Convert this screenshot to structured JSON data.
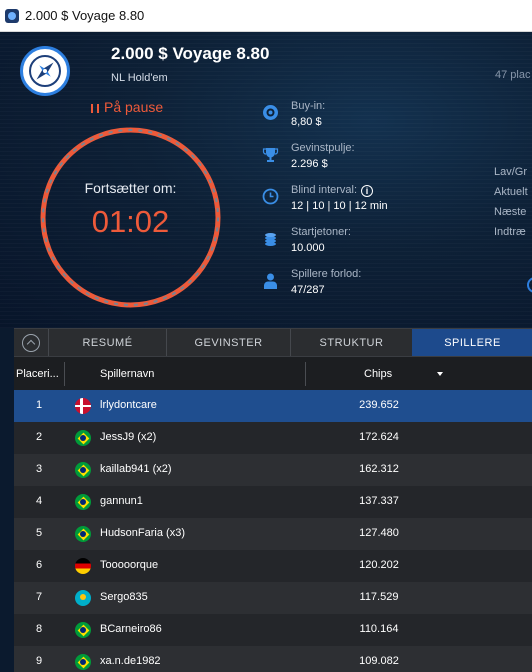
{
  "window": {
    "title": "2.000 $ Voyage 8.80"
  },
  "tournament": {
    "name": "2.000 $ Voyage 8.80",
    "game": "NL Hold'em",
    "right_partial": "47 plac"
  },
  "status": {
    "pause_text": "På pause"
  },
  "timer": {
    "label": "Fortsætter om:",
    "value": "01:02"
  },
  "info": {
    "buyin": {
      "label": "Buy-in:",
      "value": "8,80 $",
      "icon": "poker-chip-icon"
    },
    "prizepool": {
      "label": "Gevinstpulje:",
      "value": "2.296 $",
      "icon": "trophy-icon"
    },
    "blind": {
      "label": "Blind interval:",
      "value": "12 | 10 | 10 | 12 min",
      "icon": "clock-icon"
    },
    "startchips": {
      "label": "Startjetoner:",
      "value": "10.000",
      "icon": "chip-stack-icon"
    },
    "players": {
      "label": "Spillere forlod:",
      "value": "47/287",
      "icon": "player-icon"
    }
  },
  "right_panel": {
    "line1": "Lav/Gr",
    "line2": "Aktuelt",
    "line3": "Næste",
    "line4": "Indtræ"
  },
  "tabs": [
    {
      "label": "RESUMÉ"
    },
    {
      "label": "GEVINSTER"
    },
    {
      "label": "STRUKTUR"
    },
    {
      "label": "SPILLERE",
      "active": true
    }
  ],
  "table": {
    "columns": {
      "place": "Placeri...",
      "name": "Spillernavn",
      "chips": "Chips"
    },
    "rows": [
      {
        "place": "1",
        "flag": "dk",
        "name": "lrlydontcare",
        "chips": "239.652"
      },
      {
        "place": "2",
        "flag": "br",
        "name": "JessJ9 (x2)",
        "chips": "172.624"
      },
      {
        "place": "3",
        "flag": "br",
        "name": "kaillab941 (x2)",
        "chips": "162.312"
      },
      {
        "place": "4",
        "flag": "br",
        "name": "gannun1",
        "chips": "137.337"
      },
      {
        "place": "5",
        "flag": "br",
        "name": "HudsonFaria (x3)",
        "chips": "127.480"
      },
      {
        "place": "6",
        "flag": "de",
        "name": "Tooooorque",
        "chips": "120.202"
      },
      {
        "place": "7",
        "flag": "kz",
        "name": "Sergo835",
        "chips": "117.529"
      },
      {
        "place": "8",
        "flag": "br",
        "name": "BCarneiro86",
        "chips": "110.164"
      },
      {
        "place": "9",
        "flag": "br",
        "name": "xa.n.de1982",
        "chips": "109.082"
      }
    ]
  },
  "colors": {
    "accent_orange": "#ee5a3a",
    "selected_row": "#1f4e8f",
    "active_tab": "#1d4a8c",
    "header_bg": "#0d2036"
  }
}
